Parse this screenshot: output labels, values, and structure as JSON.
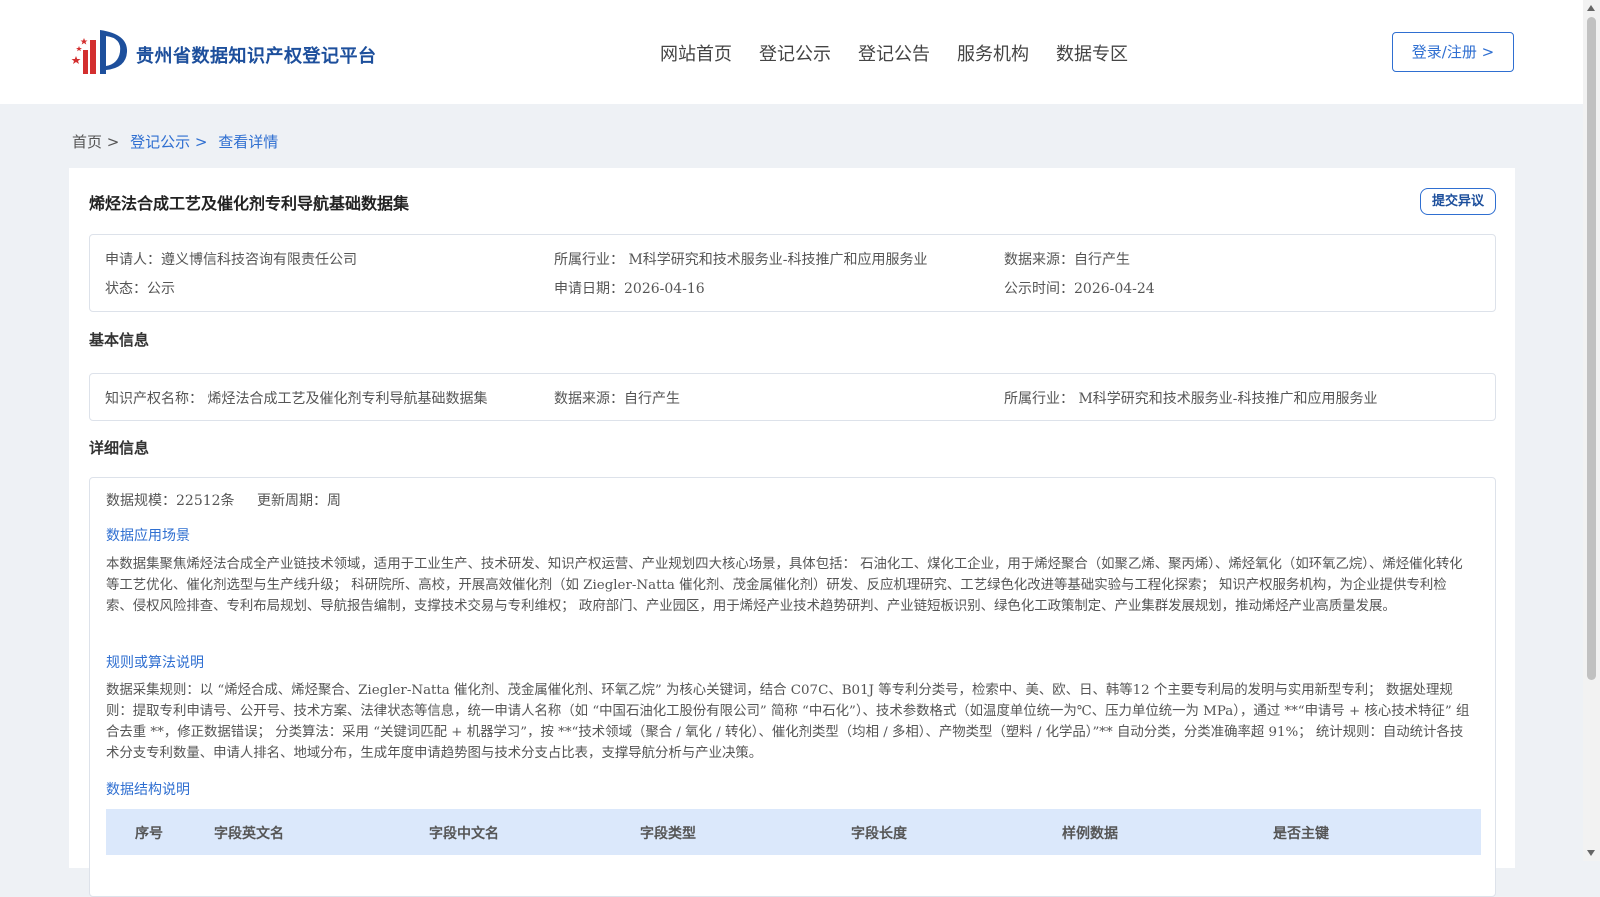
{
  "header": {
    "site_title": "贵州省数据知识产权登记平台",
    "nav": [
      "网站首页",
      "登记公示",
      "登记公告",
      "服务机构",
      "数据专区"
    ],
    "login_label": "登录/注册 >"
  },
  "breadcrumb": {
    "home": "首页 >",
    "list": "登记公示 >",
    "current": "查看详情"
  },
  "detail": {
    "title": "烯烃法合成工艺及催化剂专利导航基础数据集",
    "objection_label": "提交异议",
    "meta": {
      "applicant": "申请人：遵义博信科技咨询有限责任公司",
      "industry": "所属行业： M科学研究和技术服务业-科技推广和应用服务业",
      "source": "数据来源：自行产生",
      "status": "状态：公示",
      "apply_date": "申请日期：2026-04-16",
      "publish_date": "公示时间：2026-04-24"
    },
    "basic": {
      "section_title": "基本信息",
      "ip_name": "知识产权名称： 烯烃法合成工艺及催化剂专利导航基础数据集",
      "source": "数据来源：自行产生",
      "industry": "所属行业： M科学研究和技术服务业-科技推广和应用服务业"
    },
    "info": {
      "section_title": "详细信息",
      "scale": "数据规模：22512条",
      "cycle": "更新周期：周",
      "scenario_title": "数据应用场景",
      "scenario_text": "本数据集聚焦烯烃法合成全产业链技术领域，适用于工业生产、技术研发、知识产权运营、产业规划四大核心场景，具体包括： 石油化工、煤化工企业，用于烯烃聚合（如聚乙烯、聚丙烯）、烯烃氧化（如环氧乙烷）、烯烃催化转化等工艺优化、催化剂选型与生产线升级； 科研院所、高校，开展高效催化剂（如 Ziegler-Natta 催化剂、茂金属催化剂）研发、反应机理研究、工艺绿色化改进等基础实验与工程化探索； 知识产权服务机构，为企业提供专利检索、侵权风险排查、专利布局规划、导航报告编制，支撑技术交易与专利维权； 政府部门、产业园区，用于烯烃产业技术趋势研判、产业链短板识别、绿色化工政策制定、产业集群发展规划，推动烯烃产业高质量发展。",
      "rule_title": "规则或算法说明",
      "rule_text": "数据采集规则：以 “烯烃合成、烯烃聚合、Ziegler-Natta 催化剂、茂金属催化剂、环氧乙烷” 为核心关键词，结合 C07C、B01J 等专利分类号，检索中、美、欧、日、韩等12 个主要专利局的发明与实用新型专利； 数据处理规则：提取专利申请号、公开号、技术方案、法律状态等信息，统一申请人名称（如 “中国石油化工股份有限公司” 简称 “中石化”）、技术参数格式（如温度单位统一为℃、压力单位统一为 MPa），通过 **“申请号 + 核心技术特征” 组合去重 **，修正数据错误； 分类算法：采用 “关键词匹配 + 机器学习”，按 **“技术领域（聚合 / 氧化 / 转化）、催化剂类型（均相 / 多相）、产物类型（塑料 / 化学品）”** 自动分类，分类准确率超 91%； 统计规则：自动统计各技术分支专利数量、申请人排名、地域分布，生成年度申请趋势图与技术分支占比表，支撑导航分析与产业决策。",
      "structure_title": "数据结构说明",
      "table_headers": [
        "序号",
        "字段英文名",
        "字段中文名",
        "字段类型",
        "字段长度",
        "样例数据",
        "是否主键"
      ]
    }
  },
  "colors": {
    "brand_blue": "#1d4f9c",
    "link_blue": "#2f6fd1",
    "table_header_bg": "#dbe8fb",
    "page_bg": "#eef1f5"
  }
}
